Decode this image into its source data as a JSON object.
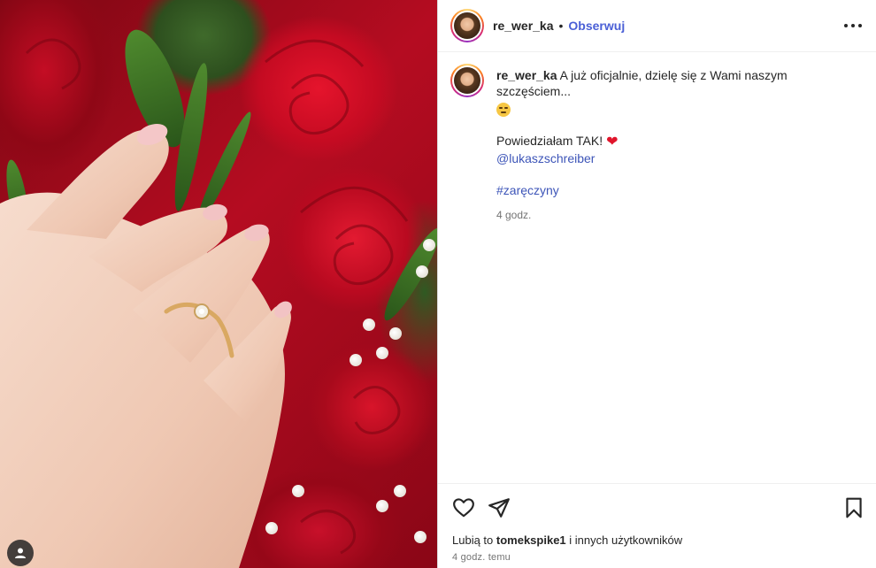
{
  "post": {
    "image_alt": "Dłoń z pierścionkiem zaręczynowym na tle czerwonych róż"
  },
  "header": {
    "username": "re_wer_ka",
    "separator": "•",
    "follow_label": "Obserwuj",
    "more_icon": "more-options-icon"
  },
  "caption": {
    "username": "re_wer_ka",
    "text": "A już oficjalnie, dzielę się z Wami naszym szczęściem...",
    "line2": "Powiedziałam TAK!",
    "heart": "❤",
    "mention": "@lukaszschreiber",
    "hashtag": "#zaręczyny",
    "time": "4 godz."
  },
  "actions": {
    "like_icon": "heart-outline-icon",
    "share_icon": "paper-plane-icon",
    "save_icon": "bookmark-icon"
  },
  "likes": {
    "prefix": "Lubią to",
    "user": "tomekspike1",
    "suffix": "i innych użytkowników"
  },
  "timestamp": "4 godz. temu",
  "colors": {
    "link": "#3d55b8",
    "follow": "#4a5fd6",
    "heart": "#e0152b"
  }
}
